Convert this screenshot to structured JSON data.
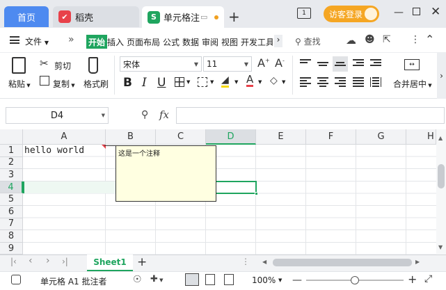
{
  "titlebar": {
    "home_tab": "首页",
    "docer_tab": "稻壳",
    "active_tab": "单元格注",
    "new_tab": "+",
    "visit_login": "访客登录",
    "colors": {
      "home": "#4e8af0",
      "brand": "#1fa55f",
      "accent": "#f5a623"
    }
  },
  "menu": {
    "file": "文件",
    "more": "»",
    "tabs": [
      "开始",
      "插入",
      "页面布局",
      "公式",
      "数据",
      "审阅",
      "视图",
      "开发工具"
    ],
    "search": "查找"
  },
  "ribbon": {
    "paste": "粘贴",
    "cut": "剪切",
    "copy": "复制",
    "format_painter": "格式刷",
    "font_name": "宋体",
    "font_size": "11",
    "merge_center": "合并居中",
    "bold": "B",
    "italic": "I",
    "underline": "U"
  },
  "formula_bar": {
    "name_box": "D4",
    "fx": "fx",
    "value": ""
  },
  "grid": {
    "columns": [
      "A",
      "B",
      "C",
      "D",
      "E",
      "F",
      "G",
      "H"
    ],
    "rows": [
      "1",
      "2",
      "3",
      "4",
      "5",
      "6",
      "7",
      "8",
      "9"
    ],
    "cells": {
      "A1": "hello world"
    },
    "selected_cell": "D4"
  },
  "comment": {
    "text": "这是一个注释"
  },
  "sheets": {
    "tabs": [
      "Sheet1"
    ],
    "add": "+"
  },
  "statusbar": {
    "mode": "单元格 A1 批注者",
    "zoom": "100%",
    "zoom_level": 0.5
  }
}
